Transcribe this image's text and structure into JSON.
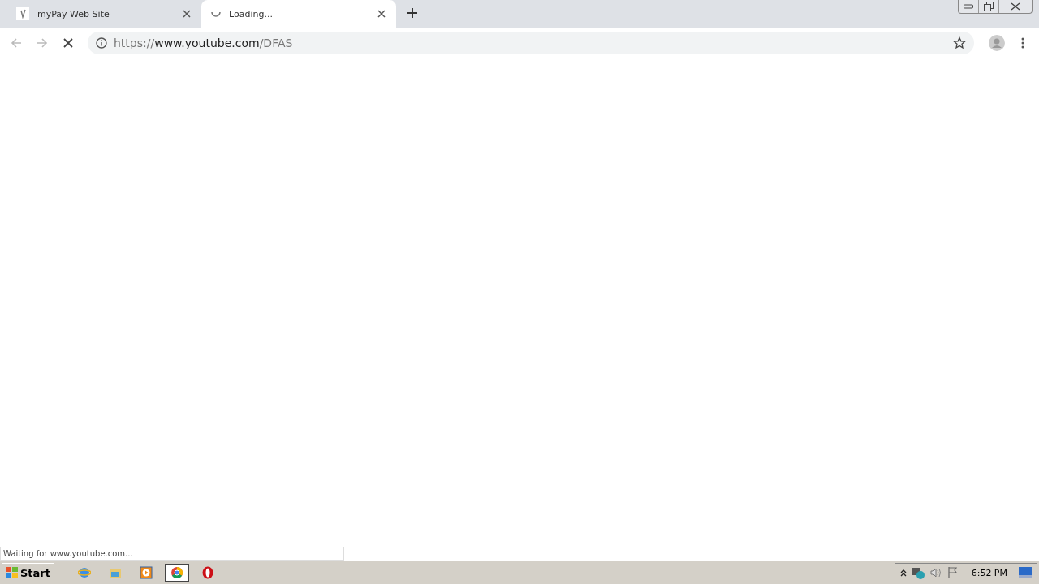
{
  "tabs": [
    {
      "title": "myPay Web Site",
      "loading": false,
      "selected": false
    },
    {
      "title": "Loading...",
      "loading": true,
      "selected": true
    }
  ],
  "address_bar": {
    "scheme": "https://",
    "host": "www.youtube.com",
    "path": "/DFAS"
  },
  "status_bubble": "Waiting for www.youtube.com...",
  "taskbar": {
    "start": "Start",
    "apps": [
      {
        "kind": "ie",
        "selected": false
      },
      {
        "kind": "folder",
        "selected": false
      },
      {
        "kind": "media",
        "selected": false
      },
      {
        "kind": "chrome",
        "selected": true
      },
      {
        "kind": "opera",
        "selected": false
      }
    ],
    "clock": "6:52 PM"
  }
}
